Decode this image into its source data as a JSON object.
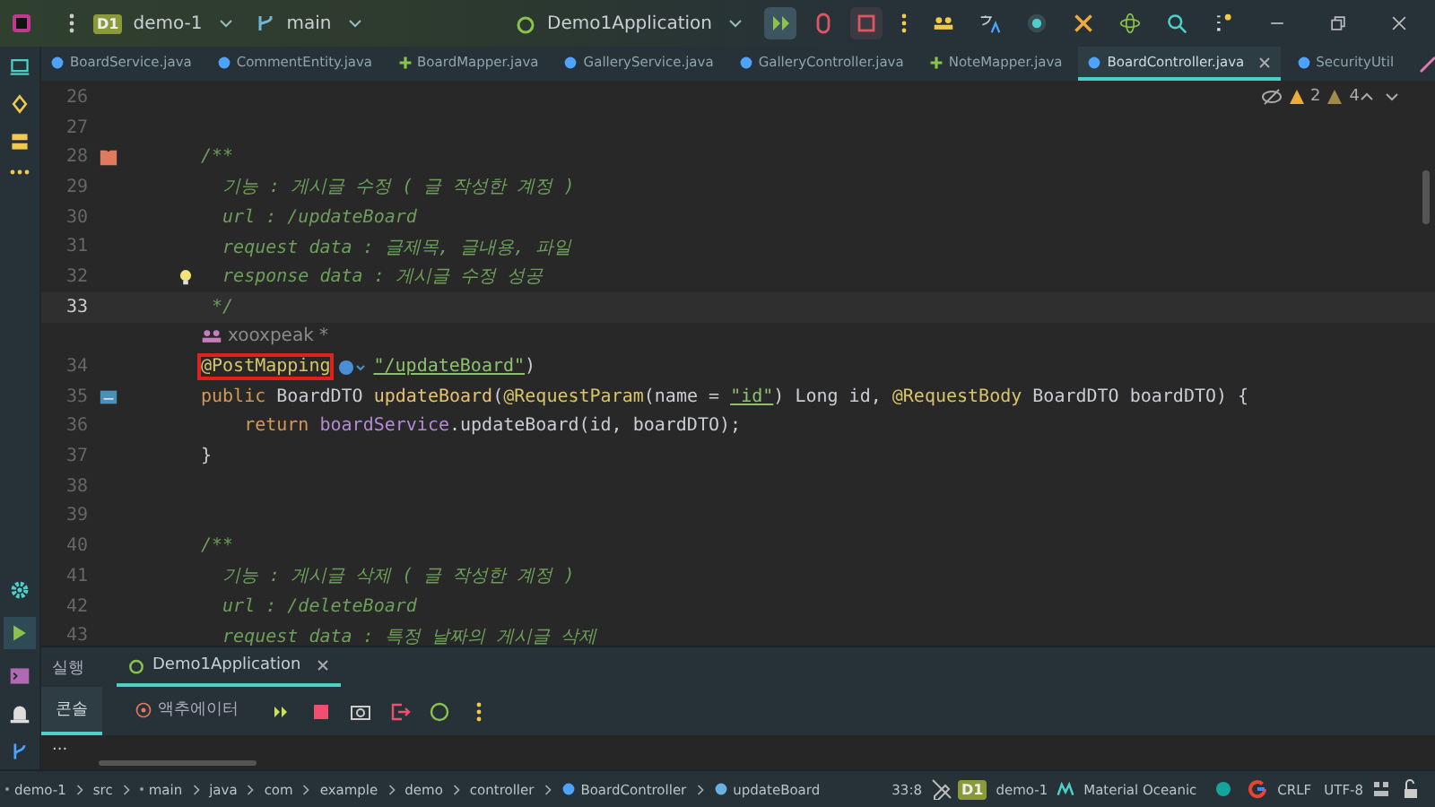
{
  "title_bar": {
    "project_badge": "D1",
    "project": "demo-1",
    "branch": "main",
    "run_config": "Demo1Application"
  },
  "tabs": [
    {
      "label": "BoardService.java",
      "kind": "class",
      "selected": false
    },
    {
      "label": "CommentEntity.java",
      "kind": "class",
      "selected": false
    },
    {
      "label": "BoardMapper.java",
      "kind": "mapper",
      "selected": false
    },
    {
      "label": "GalleryService.java",
      "kind": "class",
      "selected": false
    },
    {
      "label": "GalleryController.java",
      "kind": "class",
      "selected": false
    },
    {
      "label": "NoteMapper.java",
      "kind": "mapper",
      "selected": false
    },
    {
      "label": "BoardController.java",
      "kind": "class",
      "selected": true
    },
    {
      "label": "SecurityUtil",
      "kind": "class",
      "selected": false
    }
  ],
  "editor": {
    "inspection": {
      "warnings": "2",
      "weak_warnings": "4"
    },
    "lines": [
      {
        "kind": "code",
        "number": "26",
        "current": false
      },
      {
        "kind": "code",
        "number": "27",
        "current": false
      },
      {
        "kind": "code",
        "number": "28",
        "current": false,
        "gutter": {
          "kind": "bookmark"
        },
        "tokens": [
          {
            "kind": "comment",
            "text": "/**"
          }
        ]
      },
      {
        "kind": "code",
        "number": "29",
        "current": false,
        "tokens": [
          {
            "kind": "comment",
            "text": "  기능 : 게시글 수정 ( 글 작성한 계정 )"
          }
        ]
      },
      {
        "kind": "code",
        "number": "30",
        "current": false,
        "tokens": [
          {
            "kind": "comment",
            "text": "  url : /updateBoard"
          }
        ]
      },
      {
        "kind": "code",
        "number": "31",
        "current": false,
        "tokens": [
          {
            "kind": "comment",
            "text": "  request data : 글제목, 글내용, 파일"
          }
        ]
      },
      {
        "kind": "code",
        "number": "32",
        "current": false,
        "gutter": {
          "kind": "bulb"
        },
        "tokens": [
          {
            "kind": "comment",
            "text": "  response data : 게시글 수정 성공"
          }
        ]
      },
      {
        "kind": "code",
        "number": "33",
        "current": true,
        "tokens": [
          {
            "kind": "comment",
            "text": " */"
          }
        ]
      },
      {
        "kind": "inlay",
        "author": "xooxpeak *"
      },
      {
        "kind": "code",
        "number": "34",
        "current": false,
        "tokens": [
          {
            "kind": "annotation",
            "text": "@PostMapping",
            "boxed": true
          },
          {
            "kind": "url",
            "text": "\"/updateBoard\"",
            "boxed": false
          },
          {
            "kind": "plain",
            "text": ")",
            "boxed": false
          }
        ]
      },
      {
        "kind": "code",
        "number": "35",
        "current": false,
        "gutter": {
          "kind": "implements"
        },
        "tokens": [
          {
            "kind": "keyword",
            "text": "public "
          },
          {
            "kind": "plain",
            "text": "BoardDTO "
          },
          {
            "kind": "method",
            "text": "updateBoard"
          },
          {
            "kind": "plain",
            "text": "("
          },
          {
            "kind": "annotation",
            "text": "@RequestParam"
          },
          {
            "kind": "plain",
            "text": "(name = "
          },
          {
            "kind": "string",
            "text": "\"id\""
          },
          {
            "kind": "plain",
            "text": ") Long id, "
          },
          {
            "kind": "annotation",
            "text": "@RequestBody"
          },
          {
            "kind": "plain",
            "text": " BoardDTO boardDTO) {"
          }
        ]
      },
      {
        "kind": "code",
        "number": "36",
        "current": false,
        "tokens": [
          {
            "kind": "keyword",
            "text": "    return "
          },
          {
            "kind": "field",
            "text": "boardService"
          },
          {
            "kind": "plain",
            "text": ".updateBoard(id, boardDTO);"
          }
        ]
      },
      {
        "kind": "code",
        "number": "37",
        "current": false,
        "tokens": [
          {
            "kind": "plain",
            "text": "}"
          }
        ]
      },
      {
        "kind": "code",
        "number": "38",
        "current": false
      },
      {
        "kind": "code",
        "number": "39",
        "current": false
      },
      {
        "kind": "code",
        "number": "40",
        "current": false,
        "tokens": [
          {
            "kind": "comment",
            "text": "/**"
          }
        ]
      },
      {
        "kind": "code",
        "number": "41",
        "current": false,
        "tokens": [
          {
            "kind": "comment",
            "text": "  기능 : 게시글 삭제 ( 글 작성한 계정 )"
          }
        ]
      },
      {
        "kind": "code",
        "number": "42",
        "current": false,
        "tokens": [
          {
            "kind": "comment",
            "text": "  url : /deleteBoard"
          }
        ]
      },
      {
        "kind": "code",
        "number": "43",
        "current": false,
        "tokens": [
          {
            "kind": "comment",
            "text": "  request data : 특정 날짜의 게시글 삭제"
          }
        ]
      }
    ]
  },
  "run_panel": {
    "title": "실행",
    "tabs": [
      {
        "label": "Demo1Application",
        "selected": true
      }
    ],
    "subtabs": [
      {
        "label": "콘솔",
        "kind": "text",
        "selected": true
      },
      {
        "label": "액추에이터",
        "kind": "actuator",
        "selected": false
      }
    ],
    "more": "..."
  },
  "status_bar": {
    "breadcrumbs": [
      {
        "label": "demo-1",
        "kind": "module"
      },
      {
        "label": "src",
        "kind": "folder"
      },
      {
        "label": "main",
        "kind": "module"
      },
      {
        "label": "java",
        "kind": "folder"
      },
      {
        "label": "com",
        "kind": "folder"
      },
      {
        "label": "example",
        "kind": "folder"
      },
      {
        "label": "demo",
        "kind": "folder"
      },
      {
        "label": "controller",
        "kind": "folder"
      },
      {
        "label": "BoardController",
        "kind": "class"
      },
      {
        "label": "updateBoard",
        "kind": "method"
      }
    ],
    "position": "33:8",
    "project_badge": "D1",
    "project": "demo-1",
    "theme": "Material Oceanic",
    "line_separator": "CRLF",
    "encoding": "UTF-8"
  }
}
